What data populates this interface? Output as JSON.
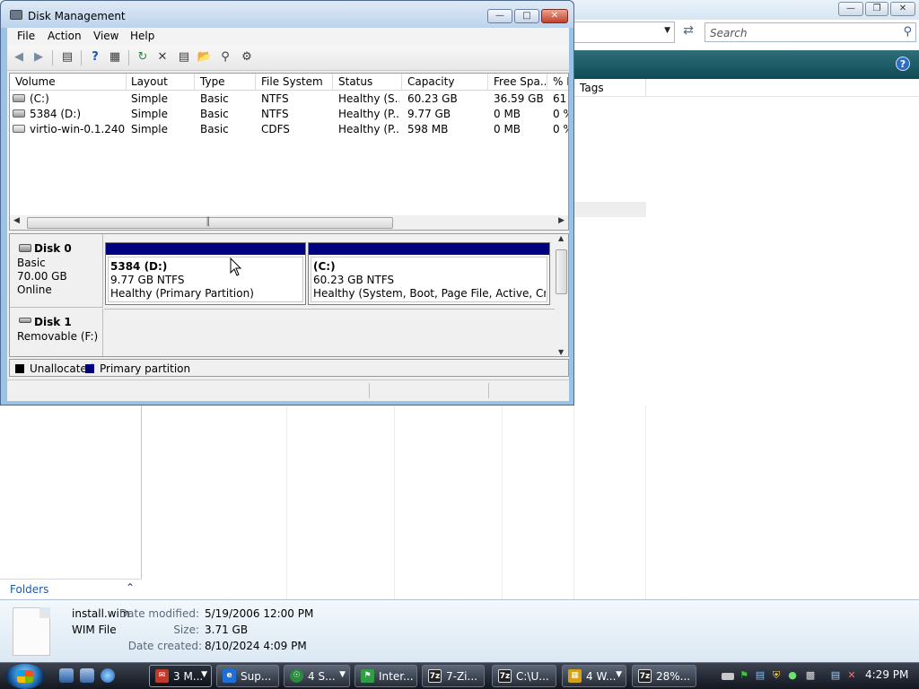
{
  "explorer": {
    "search_placeholder": "Search",
    "column_tags": "Tags",
    "folders_label": "Folders",
    "details": {
      "file_name": "install.wim",
      "file_type": "WIM File",
      "date_modified_label": "Date modified:",
      "date_modified": "5/19/2006 12:00 PM",
      "size_label": "Size:",
      "size": "3.71 GB",
      "date_created_label": "Date created:",
      "date_created": "8/10/2024 4:09 PM"
    }
  },
  "disk_management": {
    "title": "Disk Management",
    "menu": [
      "File",
      "Action",
      "View",
      "Help"
    ],
    "columns": [
      "Volume",
      "Layout",
      "Type",
      "File System",
      "Status",
      "Capacity",
      "Free Spa...",
      "% F"
    ],
    "volumes": [
      {
        "volume": "(C:)",
        "layout": "Simple",
        "type": "Basic",
        "fs": "NTFS",
        "status": "Healthy (S...",
        "capacity": "60.23 GB",
        "free": "36.59 GB",
        "pct": "61"
      },
      {
        "volume": "5384 (D:)",
        "layout": "Simple",
        "type": "Basic",
        "fs": "NTFS",
        "status": "Healthy (P...",
        "capacity": "9.77 GB",
        "free": "0 MB",
        "pct": "0 %"
      },
      {
        "volume": "virtio-win-0.1.240 ...",
        "layout": "Simple",
        "type": "Basic",
        "fs": "CDFS",
        "status": "Healthy (P...",
        "capacity": "598 MB",
        "free": "0 MB",
        "pct": "0 %"
      }
    ],
    "disks": [
      {
        "name": "Disk 0",
        "kind": "Basic",
        "size": "70.00 GB",
        "state": "Online",
        "partitions": [
          {
            "label": "5384  (D:)",
            "size_fs": "9.77 GB NTFS",
            "status": "Healthy (Primary Partition)"
          },
          {
            "label": "(C:)",
            "size_fs": "60.23 GB NTFS",
            "status": "Healthy (System, Boot, Page File, Active, Crash D"
          }
        ]
      },
      {
        "name": "Disk 1",
        "kind": "Removable (F:)"
      }
    ],
    "legend": [
      {
        "label": "Unallocated",
        "color": "#000000"
      },
      {
        "label": "Primary partition",
        "color": "#000080"
      }
    ]
  },
  "taskbar": {
    "buttons": [
      {
        "label": "3 M...",
        "color": "#c0392b"
      },
      {
        "label": "Sup...",
        "color": "#1e6fd9"
      },
      {
        "label": "4 S...",
        "color": "#2b8a3e"
      },
      {
        "label": "Inter...",
        "color": "#2f9e44"
      },
      {
        "label": "7-Zi...",
        "color": "#222222"
      },
      {
        "label": "C:\\U...",
        "color": "#222222"
      },
      {
        "label": "4 W...",
        "color": "#d4a017"
      },
      {
        "label": "28%...",
        "color": "#222222"
      }
    ],
    "clock": "4:29 PM"
  }
}
